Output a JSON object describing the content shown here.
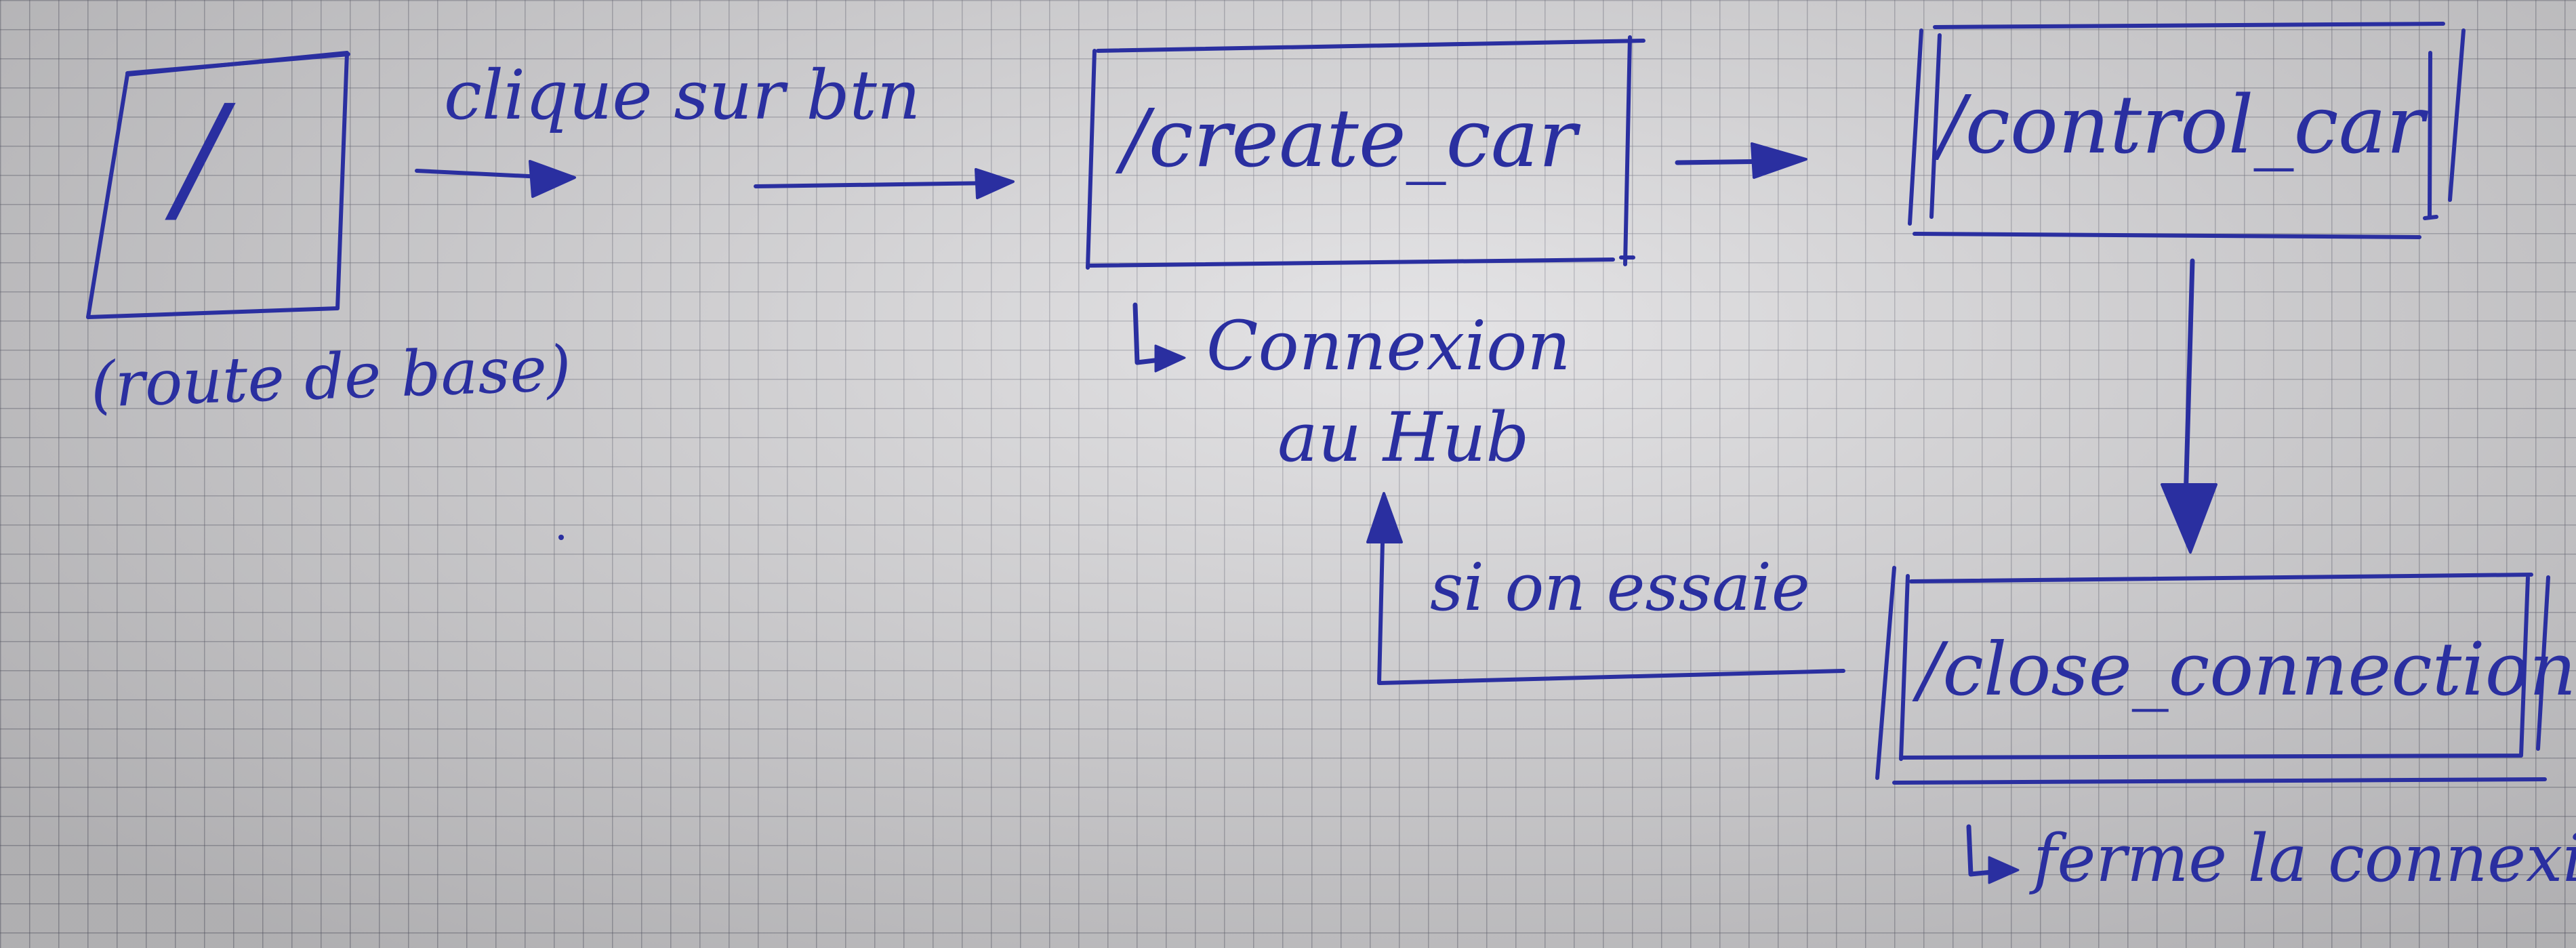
{
  "nodes": {
    "root": {
      "label": "/",
      "note": "(route de base)"
    },
    "create_car": {
      "label": "/create_car",
      "note_line1": "Connexion",
      "note_line2": "au Hub"
    },
    "control_car": {
      "label": "/control_car"
    },
    "close_connection": {
      "label": "/close_connection",
      "note": "ferme la connexion"
    }
  },
  "edges": {
    "root_to_create": {
      "label": "clique sur btn"
    },
    "close_to_create": {
      "label": "si on essaie"
    }
  },
  "colors": {
    "ink": "#2a2fa0",
    "paper": "#d6d5d8",
    "grid": "#5f5f6e"
  }
}
